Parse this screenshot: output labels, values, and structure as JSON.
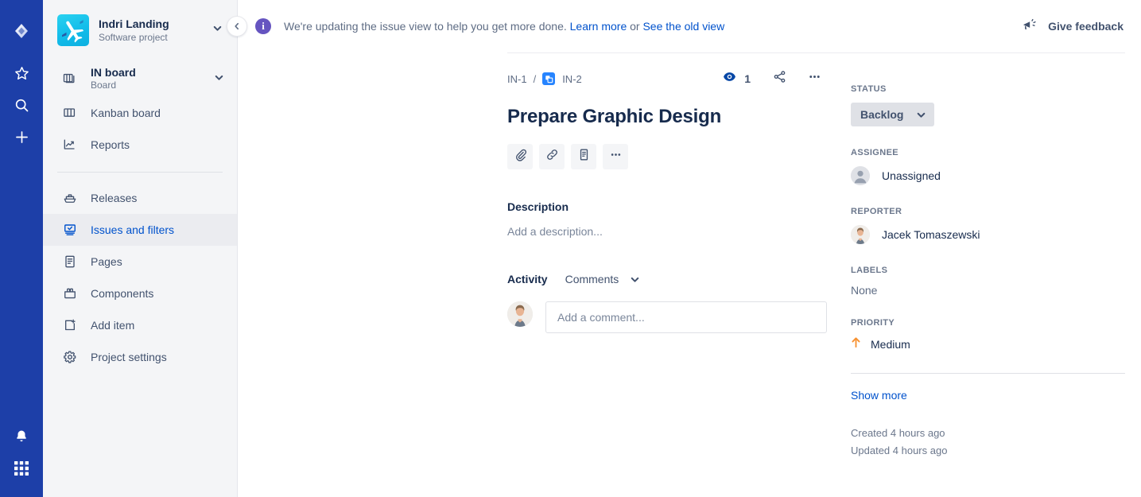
{
  "rail": {
    "logo_icon": "jira-logo-icon",
    "items": [
      {
        "icon": "star-icon",
        "name": "starred"
      },
      {
        "icon": "search-icon",
        "name": "search"
      },
      {
        "icon": "plus-icon",
        "name": "create"
      }
    ],
    "bottom_items": [
      {
        "icon": "notification-bell-icon",
        "name": "notifications"
      },
      {
        "icon": "app-switcher-grid-icon",
        "name": "app-switcher"
      }
    ]
  },
  "sidebar": {
    "project": {
      "name": "Indri Landing",
      "type": "Software project",
      "avatar_icon": "airplane-project-avatar",
      "chevron_icon": "chevron-down-icon"
    },
    "board": {
      "name": "IN board",
      "sub": "Board",
      "icon": "board-stack-icon",
      "chevron_icon": "chevron-down-icon"
    },
    "items": [
      {
        "label": "Kanban board",
        "icon": "columns-icon",
        "selected": false
      },
      {
        "label": "Reports",
        "icon": "chart-line-icon",
        "selected": false
      },
      {
        "label": "Releases",
        "icon": "ship-icon",
        "selected": false
      },
      {
        "label": "Issues and filters",
        "icon": "issues-filters-icon",
        "selected": true
      },
      {
        "label": "Pages",
        "icon": "page-icon",
        "selected": false
      },
      {
        "label": "Components",
        "icon": "components-icon",
        "selected": false
      },
      {
        "label": "Add item",
        "icon": "add-item-icon",
        "selected": false
      },
      {
        "label": "Project settings",
        "icon": "gear-icon",
        "selected": false
      }
    ],
    "collapse_icon": "chevron-left-icon"
  },
  "banner": {
    "info_icon": "info-circle-icon",
    "text_before": "We're updating the issue view to help you get more done.",
    "link_learn_more": "Learn more",
    "text_or": "or",
    "link_old_view": "See the old view",
    "feedback_label": "Give feedback",
    "feedback_icon": "megaphone-icon"
  },
  "issue": {
    "breadcrumb": {
      "parent": "IN-1",
      "separator": "/",
      "type_icon": "task-type-icon",
      "current": "IN-2"
    },
    "title": "Prepare Graphic Design",
    "watch_count": "1",
    "watch_icon": "watch-eye-icon",
    "share_icon": "share-icon",
    "more_icon": "more-options-icon",
    "action_buttons": [
      {
        "name": "attach",
        "icon": "paperclip-icon"
      },
      {
        "name": "link-issue",
        "icon": "link-icon"
      },
      {
        "name": "add-page",
        "icon": "document-icon"
      },
      {
        "name": "more",
        "icon": "more-options-icon"
      }
    ],
    "description": {
      "heading": "Description",
      "placeholder": "Add a description..."
    },
    "activity": {
      "label": "Activity",
      "tab": "Comments",
      "tab_chevron_icon": "chevron-down-icon",
      "comment_placeholder": "Add a comment...",
      "avatar_icon": "user-avatar-photo"
    }
  },
  "details": {
    "status": {
      "label": "STATUS",
      "value": "Backlog",
      "chevron_icon": "chevron-down-icon"
    },
    "assignee": {
      "label": "ASSIGNEE",
      "value": "Unassigned",
      "avatar_icon": "default-user-avatar-icon"
    },
    "reporter": {
      "label": "REPORTER",
      "value": "Jacek Tomaszewski",
      "avatar_icon": "user-avatar-photo"
    },
    "labels": {
      "label": "LABELS",
      "value": "None"
    },
    "priority": {
      "label": "PRIORITY",
      "value": "Medium",
      "icon": "priority-medium-arrow-up-icon",
      "color": "#f79232"
    },
    "show_more": "Show more",
    "created": "Created 4 hours ago",
    "updated": "Updated 4 hours ago"
  },
  "colors": {
    "rail_blue": "#1d3fa8",
    "sidebar_bg": "#f4f5f7",
    "link_blue": "#0052cc",
    "info_purple": "#6554c0",
    "priority_orange": "#f79232",
    "type_icon_blue": "#2684ff"
  }
}
